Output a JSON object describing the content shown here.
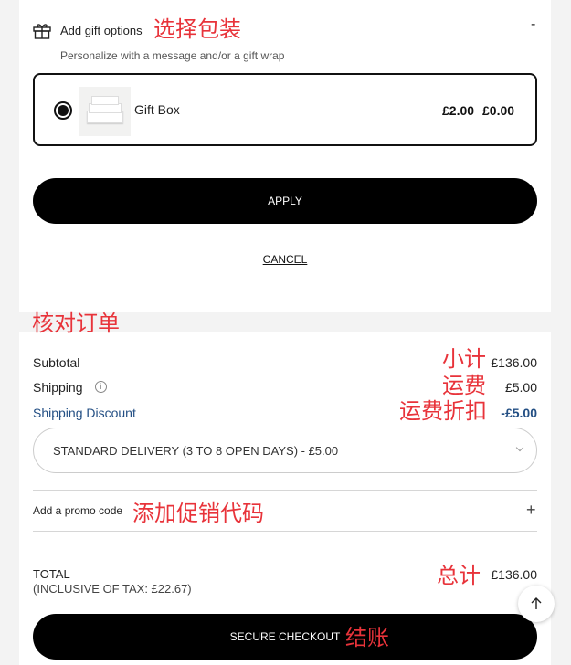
{
  "gift": {
    "title": "Add gift options",
    "subtitle": "Personalize with a message and/or a gift wrap",
    "collapse_symbol": "-",
    "option": {
      "name": "Gift Box",
      "old_price": "£2.00",
      "new_price": "£0.00",
      "selected": true,
      "image_icon": "gift-box-image"
    },
    "apply_label": "APPLY",
    "cancel_label": "CANCEL"
  },
  "summary": {
    "subtotal_label": "Subtotal",
    "subtotal_value": "£136.00",
    "shipping_label": "Shipping",
    "shipping_info_symbol": "i",
    "shipping_value": "£5.00",
    "discount_label": "Shipping Discount",
    "discount_value": "-£5.00",
    "delivery_option": "STANDARD DELIVERY (3 TO 8 OPEN DAYS) - £5.00",
    "promo_label": "Add a promo code",
    "promo_symbol": "+",
    "total_label": "TOTAL",
    "tax_label": "(INCLUSIVE OF TAX: £22.67)",
    "total_value": "£136.00",
    "checkout_label": "SECURE CHECKOUT"
  },
  "annotations": {
    "gift": "选择包装",
    "review": "核对订单",
    "subtotal": "小计",
    "shipping": "运费",
    "discount": "运费折扣",
    "promo": "添加促销代码",
    "total": "总计",
    "checkout": "结账"
  },
  "colors": {
    "annotation": "#e8333a",
    "discount_blue": "#234f84",
    "button_bg": "#000000",
    "panel_bg": "#ffffff",
    "page_bg": "#f3f3f3"
  }
}
